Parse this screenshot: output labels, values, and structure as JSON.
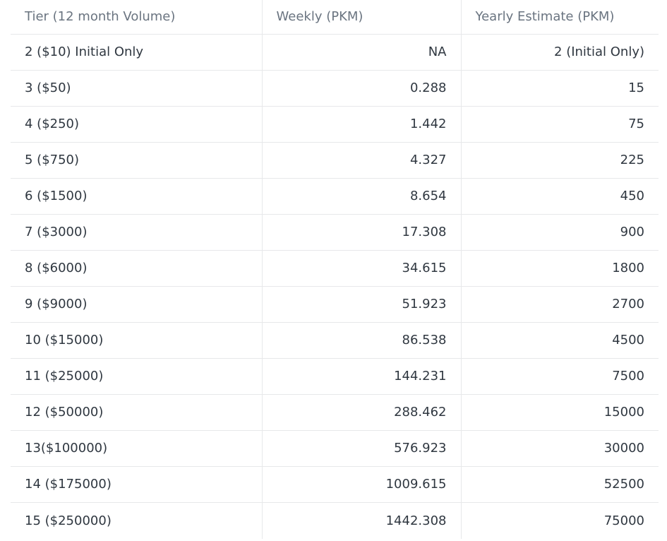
{
  "table": {
    "headers": [
      "Tier (12 month Volume)",
      "Weekly (PKM)",
      "Yearly Estimate (PKM)"
    ],
    "rows": [
      {
        "tier": "2 ($10) Initial Only",
        "weekly": "NA",
        "yearly": "2 (Initial Only)"
      },
      {
        "tier": "3 ($50)",
        "weekly": "0.288",
        "yearly": "15"
      },
      {
        "tier": "4 ($250)",
        "weekly": "1.442",
        "yearly": "75"
      },
      {
        "tier": "5 ($750)",
        "weekly": "4.327",
        "yearly": "225"
      },
      {
        "tier": "6 ($1500)",
        "weekly": "8.654",
        "yearly": "450"
      },
      {
        "tier": "7 ($3000)",
        "weekly": "17.308",
        "yearly": "900"
      },
      {
        "tier": "8 ($6000)",
        "weekly": "34.615",
        "yearly": "1800"
      },
      {
        "tier": "9 ($9000)",
        "weekly": "51.923",
        "yearly": "2700"
      },
      {
        "tier": "10 ($15000)",
        "weekly": "86.538",
        "yearly": "4500"
      },
      {
        "tier": "11 ($25000)",
        "weekly": "144.231",
        "yearly": "7500"
      },
      {
        "tier": "12 ($50000)",
        "weekly": "288.462",
        "yearly": "15000"
      },
      {
        "tier": "13($100000)",
        "weekly": "576.923",
        "yearly": "30000"
      },
      {
        "tier": "14 ($175000)",
        "weekly": "1009.615",
        "yearly": "52500"
      },
      {
        "tier": "15 ($250000)",
        "weekly": "1442.308",
        "yearly": "75000"
      }
    ]
  }
}
